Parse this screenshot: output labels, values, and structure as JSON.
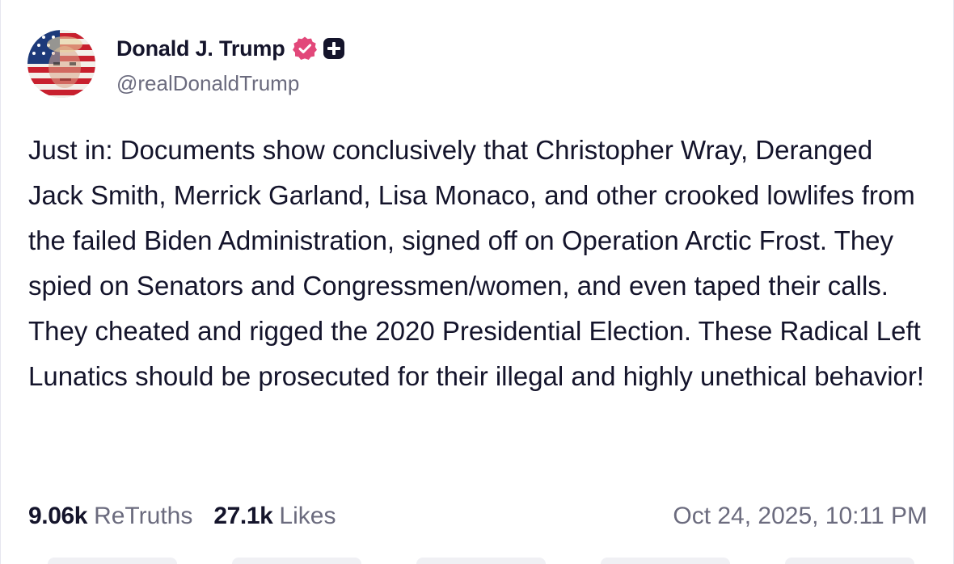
{
  "author": {
    "display_name": "Donald J. Trump",
    "handle": "@realDonaldTrump",
    "avatar_icon": "avatar-flag-portrait",
    "verified_icon": "verified-badge-icon",
    "plus_icon": "plus-badge-icon"
  },
  "post": {
    "text": "Just in: Documents show conclusively that Christopher Wray, Deranged Jack Smith, Merrick Garland, Lisa Monaco, and other crooked lowlifes from the failed Biden Administration, signed off on Operation Arctic Frost. They spied on Senators and Congressmen/women, and even taped their calls. They cheated and rigged the 2020 Presidential Election. These Radical Left Lunatics should be prosecuted for their illegal and highly unethical behavior!"
  },
  "stats": {
    "retruths_count": "9.06k",
    "retruths_label": "ReTruths",
    "likes_count": "27.1k",
    "likes_label": "Likes"
  },
  "timestamp": "Oct 24, 2025, 10:11 PM",
  "colors": {
    "text_primary": "#14142b",
    "text_secondary": "#6b6b7e",
    "verified": "#e2487a",
    "plus_badge": "#14142b"
  }
}
